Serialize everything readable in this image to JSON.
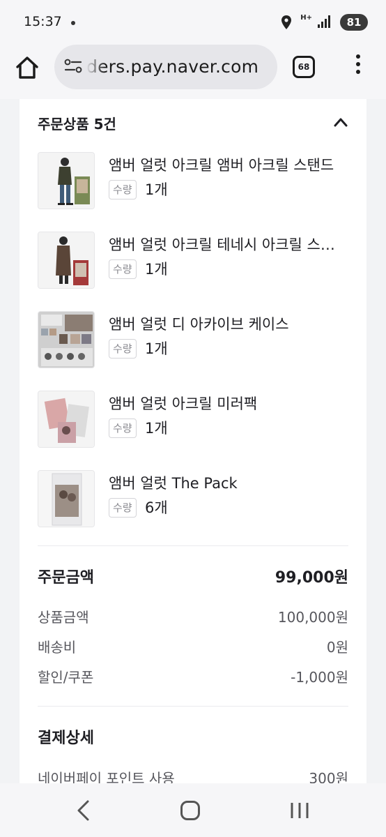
{
  "status_bar": {
    "time": "15:37",
    "network": "H+",
    "battery": "81"
  },
  "browser": {
    "url": "ders.pay.naver.com",
    "tab_count": "68"
  },
  "order": {
    "section_title": "주문상품 5건",
    "qty_label": "수량",
    "items": [
      {
        "name": "앰버 얼럿 아크릴 앰버 아크릴 스탠드",
        "qty": "1개",
        "thumb": "acrylic-stand-amber"
      },
      {
        "name": "앰버 얼럿 아크릴 테네시 아크릴 스탠드",
        "qty": "1개",
        "thumb": "acrylic-stand-tennessee"
      },
      {
        "name": "앰버 얼럿 디 아카이브 케이스",
        "qty": "1개",
        "thumb": "archive-case"
      },
      {
        "name": "앰버 얼럿 아크릴 미러팩",
        "qty": "1개",
        "thumb": "mirror-pack"
      },
      {
        "name": "앰버 얼럿 The Pack",
        "qty": "6개",
        "thumb": "the-pack"
      }
    ]
  },
  "summary": {
    "order_total_label": "주문금액",
    "order_total_value": "99,000원",
    "product_label": "상품금액",
    "product_value": "100,000원",
    "shipping_label": "배송비",
    "shipping_value": "0원",
    "discount_label": "할인/쿠폰",
    "discount_value": "-1,000원"
  },
  "payment": {
    "title": "결제상세",
    "point_label": "네이버페이 포인트 사용",
    "point_value": "300원"
  },
  "colors": {
    "background": "#f2f3f5",
    "card": "#ffffff",
    "text": "#1e1e23",
    "muted": "#56565c"
  }
}
